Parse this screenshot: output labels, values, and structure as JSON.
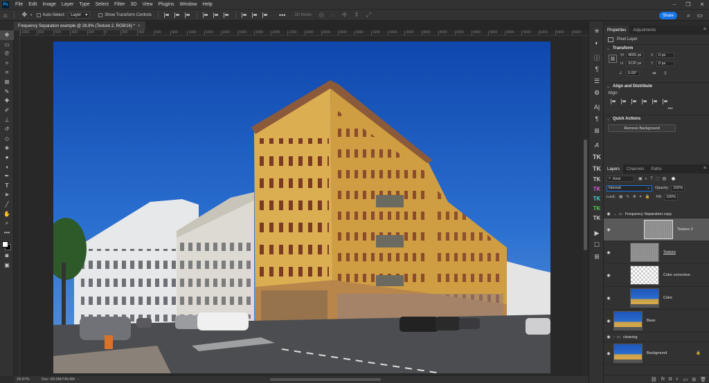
{
  "app": {
    "logo": "Ps",
    "menu": [
      "File",
      "Edit",
      "Image",
      "Layer",
      "Type",
      "Select",
      "Filter",
      "3D",
      "View",
      "Plugins",
      "Window",
      "Help"
    ]
  },
  "options": {
    "auto_select_label": "Auto-Select:",
    "auto_select_value": "Layer",
    "transform_controls_label": "Show Transform Controls",
    "mode_3d_label": "3D Mode:",
    "share_label": "Share"
  },
  "document": {
    "tab_title": "Frequency Separation example @ 28.9% (Texture 2, RGB/16) *",
    "zoom": "28.87%",
    "doc_info": "Doc: 83.0M/745.8M"
  },
  "rulers": {
    "h_ticks": [
      "1000",
      "800",
      "600",
      "400",
      "200",
      "0",
      "200",
      "400",
      "600",
      "800",
      "1000",
      "1200",
      "1400",
      "1600",
      "1800",
      "2000",
      "2200",
      "2400",
      "2600",
      "2800",
      "3000",
      "3200",
      "3400",
      "3600",
      "3800",
      "4000",
      "4200",
      "4400",
      "4600",
      "4800",
      "5000",
      "5200",
      "5400",
      "5600"
    ]
  },
  "properties": {
    "tabs": [
      "Properties",
      "Adjustments"
    ],
    "layer_kind": "Pixel Layer",
    "transform": {
      "title": "Transform",
      "w_label": "W",
      "w": "4665 px",
      "h_label": "H",
      "h": "3120 px",
      "x_label": "X",
      "x": "0 px",
      "y_label": "Y",
      "y": "0 px",
      "angle": "0.00°"
    },
    "align": {
      "title": "Align and Distribute",
      "label": "Align:"
    },
    "quick_actions": {
      "title": "Quick Actions",
      "remove_bg": "Remove Background"
    }
  },
  "layers": {
    "tabs": [
      "Layers",
      "Channels",
      "Paths"
    ],
    "filter_kind": "Kind",
    "blend_mode": "Normal",
    "opacity_label": "Opacity:",
    "opacity": "100%",
    "lock_label": "Lock:",
    "fill_label": "Fill:",
    "fill": "100%",
    "items": [
      {
        "name": "Frequency Separation copy",
        "type": "group"
      },
      {
        "name": "Texture 2",
        "type": "texture",
        "selected": true
      },
      {
        "name": "Texture",
        "type": "texture"
      },
      {
        "name": "Color correction",
        "type": "transparent"
      },
      {
        "name": "Color",
        "type": "photo"
      },
      {
        "name": "Base",
        "type": "photo"
      },
      {
        "name": "cleaning",
        "type": "group"
      },
      {
        "name": "Background",
        "type": "photo"
      }
    ]
  },
  "colors": {
    "accent": "#1473e6",
    "sky": "#1a5cc4",
    "facade": "#d9ad4e"
  }
}
